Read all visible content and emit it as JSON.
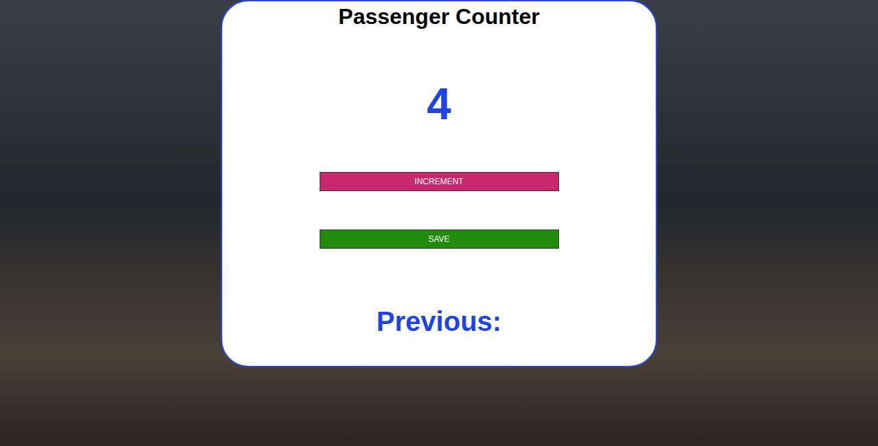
{
  "title": "Passenger Counter",
  "count": "4",
  "buttons": [
    {
      "label": "INCREMENT",
      "color": "#c8276b"
    },
    {
      "label": "SAVE",
      "color": "#218c0c"
    }
  ],
  "previous": "Previous:"
}
